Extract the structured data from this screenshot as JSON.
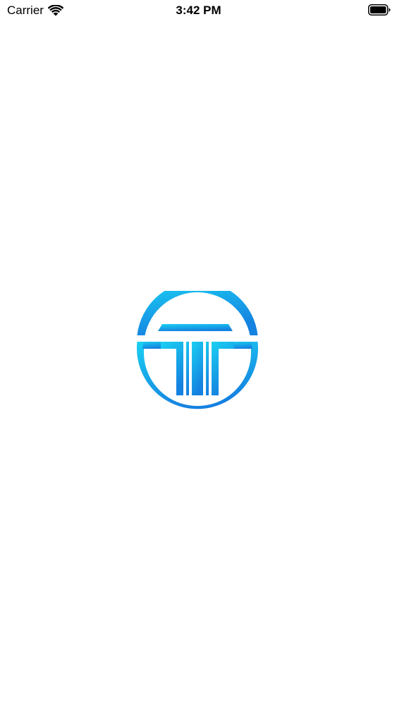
{
  "status_bar": {
    "carrier": "Carrier",
    "time": "3:42 PM",
    "wifi_icon": "wifi-icon",
    "battery_icon": "battery-full-icon"
  },
  "splash": {
    "logo_icon": "circle-t-logo-icon",
    "colors": {
      "logo_top": "#1ad0f2",
      "logo_bottom": "#1581e0",
      "background": "#ffffff"
    }
  }
}
